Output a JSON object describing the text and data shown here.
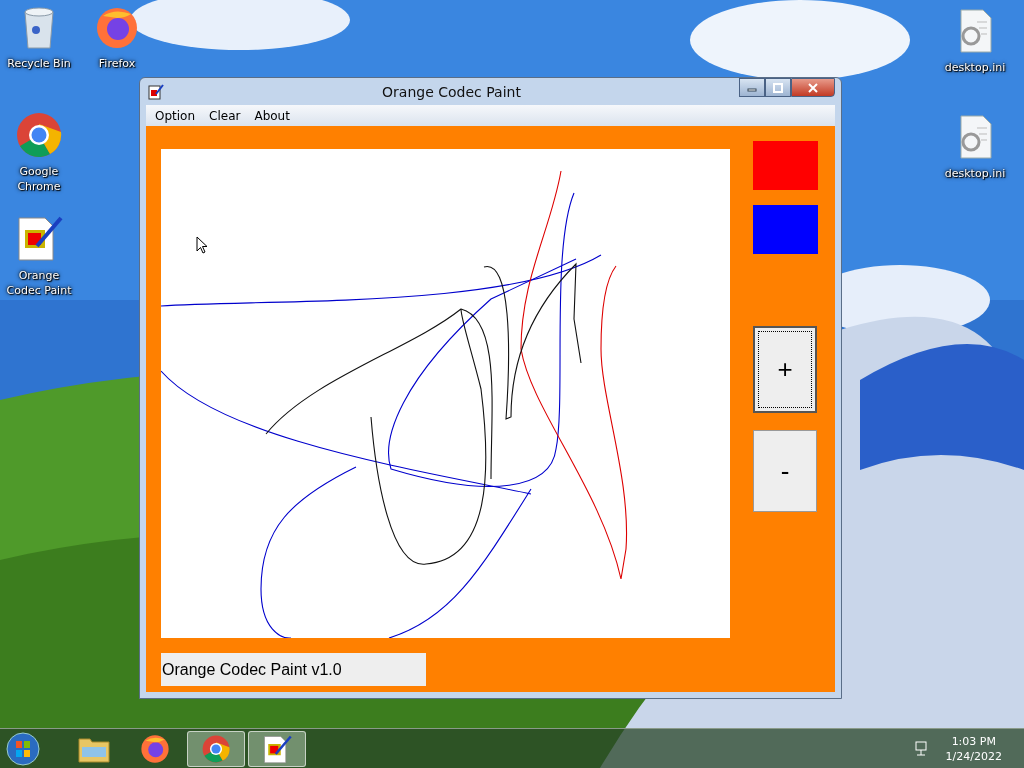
{
  "desktop_icons": [
    {
      "label": "Recycle Bin",
      "kind": "bin"
    },
    {
      "label": "Firefox",
      "kind": "firefox"
    },
    {
      "label": "Google Chrome",
      "kind": "chrome"
    },
    {
      "label": "Orange Codec Paint",
      "kind": "paint"
    },
    {
      "label": "desktop.ini",
      "kind": "file"
    },
    {
      "label": "desktop.ini",
      "kind": "file"
    }
  ],
  "window": {
    "title": "Orange Codec Paint",
    "menu": [
      "Option",
      "Clear",
      "About"
    ],
    "swatches": [
      {
        "color": "#ff0000"
      },
      {
        "color": "#0000ff"
      }
    ],
    "buttons": [
      "+",
      "-"
    ],
    "status": "Orange Codec Paint v1.0"
  },
  "taskbar": {
    "apps": [
      {
        "kind": "explorer",
        "running": false
      },
      {
        "kind": "firefox",
        "running": false
      },
      {
        "kind": "chrome",
        "running": true
      },
      {
        "kind": "paint",
        "running": true
      }
    ],
    "time": "1:03 PM",
    "date": "1/24/2022"
  }
}
